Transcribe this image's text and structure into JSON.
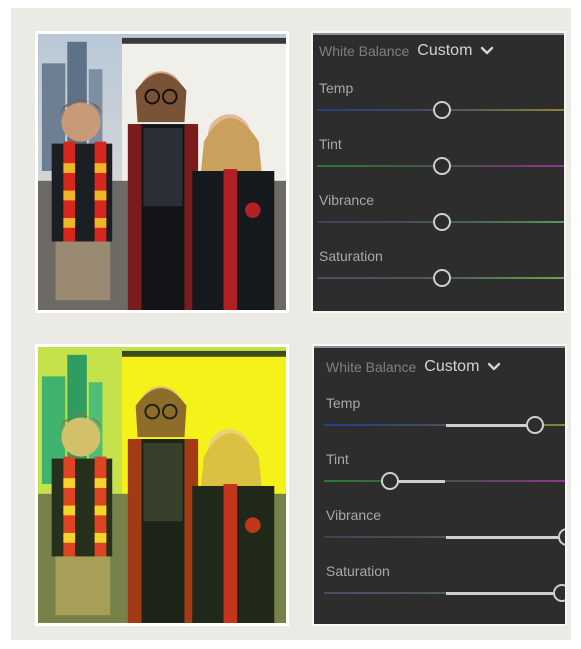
{
  "panels": [
    {
      "id": "before",
      "white_balance_label": "White Balance",
      "white_balance_value": "Custom",
      "sliders": [
        {
          "key": "temp",
          "label": "Temp",
          "value": 0.5
        },
        {
          "key": "tint",
          "label": "Tint",
          "value": 0.5
        },
        {
          "key": "vibrance",
          "label": "Vibrance",
          "value": 0.5
        },
        {
          "key": "saturation",
          "label": "Saturation",
          "value": 0.5
        }
      ]
    },
    {
      "id": "after",
      "white_balance_label": "White Balance",
      "white_balance_value": "Custom",
      "sliders": [
        {
          "key": "temp",
          "label": "Temp",
          "value": 0.87
        },
        {
          "key": "tint",
          "label": "Tint",
          "value": 0.27
        },
        {
          "key": "vibrance",
          "label": "Vibrance",
          "value": 1.0
        },
        {
          "key": "saturation",
          "label": "Saturation",
          "value": 0.98
        }
      ]
    }
  ],
  "photos": [
    {
      "id": "photo-original",
      "filter": "original",
      "shirt_text": "I'M A DEVE\nAL OF STA"
    },
    {
      "id": "photo-adjusted",
      "filter": "warm-yellow",
      "shirt_text": "I'M A DEVE\nAL OF STA"
    }
  ],
  "colors": {
    "canvas": "#eceae5",
    "panel_bg": "#2d2d2d",
    "knob": "#cfcfcf",
    "fill": "#d0d0d0",
    "label": "#a8a8a8",
    "wb_label": "#7f7f7f"
  }
}
